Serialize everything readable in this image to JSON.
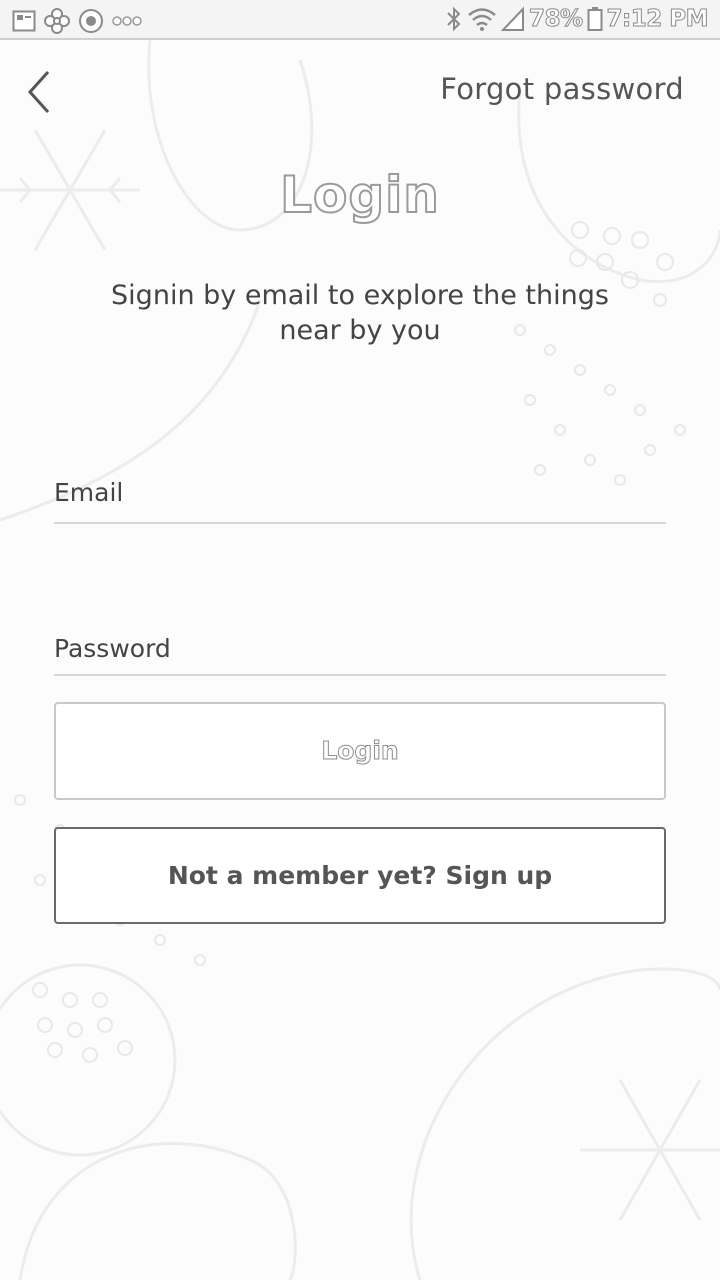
{
  "status_bar": {
    "left_icons": [
      "gallery-icon",
      "fan-icon",
      "target-icon",
      "more-dots-icon"
    ],
    "right_icons": [
      "bluetooth-icon",
      "wifi-icon",
      "signal-icon",
      "battery-icon"
    ],
    "battery": "78%",
    "time": "7:12 PM"
  },
  "header": {
    "back_icon": "chevron-left-icon",
    "forgot_label": "Forgot password"
  },
  "main": {
    "title": "Login",
    "subtitle": "Signin by email to explore the things near by you",
    "email_placeholder": "Email",
    "password_placeholder": "Password",
    "login_label": "Login",
    "signup_label": "Not a member yet? Sign up"
  },
  "colors": {
    "background": "#fcfcfc",
    "text": "#444444",
    "border_light": "#c9c9c9",
    "border_dark": "#6a6a6a"
  }
}
